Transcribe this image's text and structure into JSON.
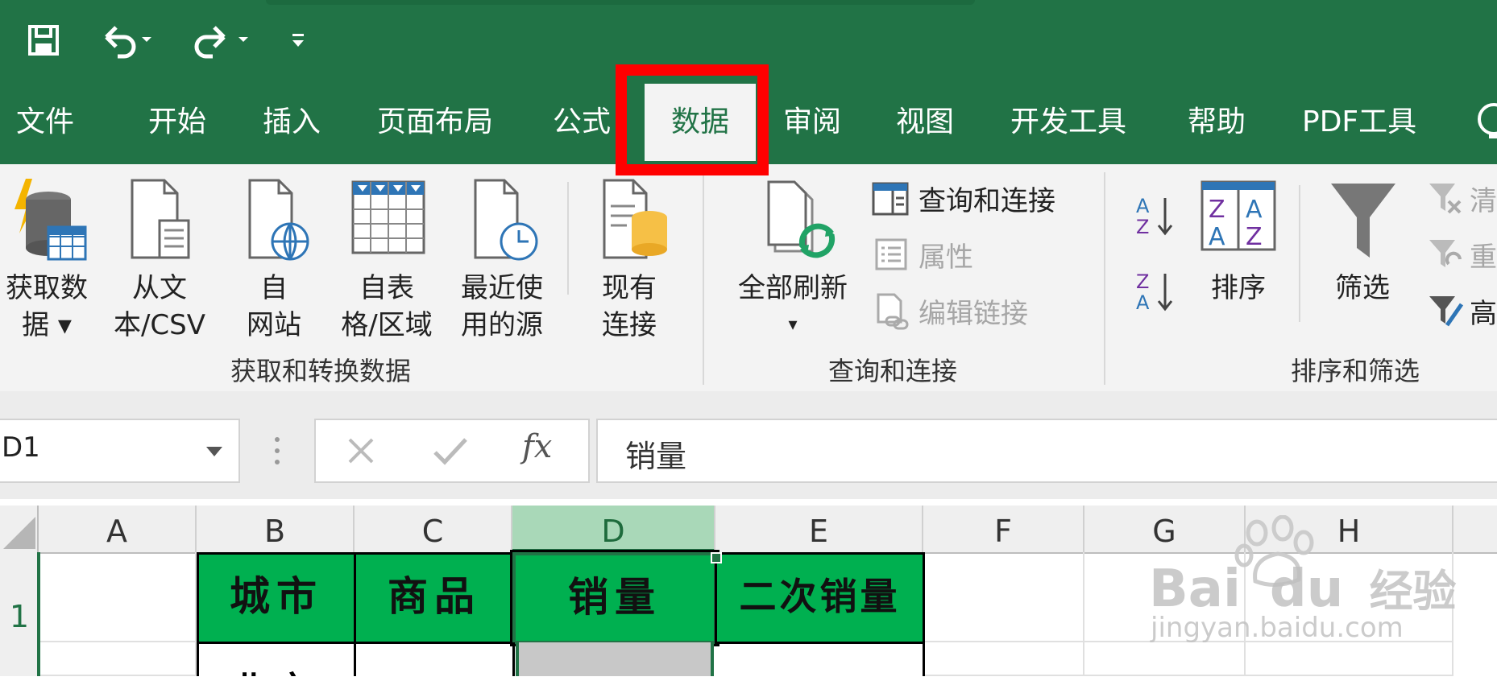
{
  "quick_access": {
    "save": "save-icon",
    "undo": "undo-icon",
    "redo": "redo-icon",
    "customize": "customize-icon"
  },
  "tabs": [
    "文件",
    "开始",
    "插入",
    "页面布局",
    "公式",
    "数据",
    "审阅",
    "视图",
    "开发工具",
    "帮助",
    "PDF工具"
  ],
  "active_tab": "数据",
  "ribbon": {
    "get_data": {
      "l1": "获取数",
      "l2": "据 ▾"
    },
    "from_text": {
      "l1": "从文",
      "l2": "本/CSV"
    },
    "from_web": {
      "l1": "自",
      "l2": "网站"
    },
    "from_table": {
      "l1": "自表",
      "l2": "格/区域"
    },
    "recent_sources": {
      "l1": "最近使",
      "l2": "用的源"
    },
    "existing_conn": {
      "l1": "现有",
      "l2": "连接"
    },
    "group1": "获取和转换数据",
    "refresh_all": {
      "l1": "全部刷新",
      "l2": "▾"
    },
    "query_conn": "查询和连接",
    "properties": "属性",
    "edit_links": "编辑链接",
    "group2": "查询和连接",
    "sort": "排序",
    "filter": "筛选",
    "clear": "清",
    "reapply": "重",
    "advanced": "高",
    "group3": "排序和筛选"
  },
  "formula_bar": {
    "name_box": "D1",
    "fx": "fx",
    "content": "销量"
  },
  "columns": [
    "A",
    "B",
    "C",
    "D",
    "E",
    "F",
    "G",
    "H"
  ],
  "rows": [
    "1"
  ],
  "header_cells": {
    "B": "城市",
    "C": "商品",
    "D": "销量",
    "E": "二次销量"
  },
  "row2_partial": "北京",
  "watermark": {
    "brand": "Bai",
    "brand2": "du",
    "cn": "经验",
    "url": "jingyan.baidu.com"
  },
  "colors": {
    "excel_green": "#217346",
    "header_fill": "#00b050",
    "highlight": "#ff0000"
  }
}
